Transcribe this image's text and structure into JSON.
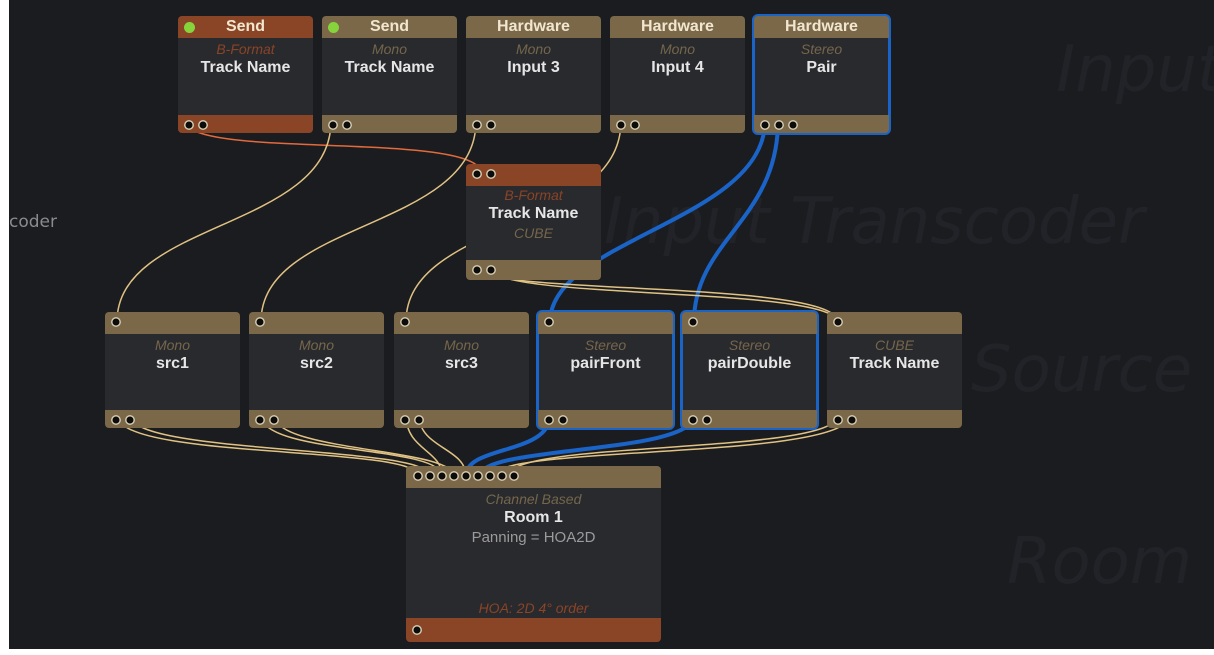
{
  "background_labels": [
    "Input",
    "Input Transcoder",
    "Source",
    "Room"
  ],
  "side_label": "coder",
  "colors": {
    "canvas": "#1b1c1f",
    "node_body": "#292a2e",
    "tan": "#7a6848",
    "orange": "#8a4426",
    "selection": "#1a64c8",
    "wire_tan": "#e0c283",
    "wire_orange": "#e26a3c",
    "wire_blue": "#1a64c8",
    "led": "#86d33b"
  },
  "inputs": [
    {
      "header": "Send",
      "format": "B-Format",
      "name": "Track Name",
      "style": "orange",
      "led": true,
      "selected": false
    },
    {
      "header": "Send",
      "format": "Mono",
      "name": "Track Name",
      "style": "tan",
      "led": true,
      "selected": false
    },
    {
      "header": "Hardware",
      "format": "Mono",
      "name": "Input 3",
      "style": "tan",
      "led": false,
      "selected": false
    },
    {
      "header": "Hardware",
      "format": "Mono",
      "name": "Input 4",
      "style": "tan",
      "led": false,
      "selected": false
    },
    {
      "header": "Hardware",
      "format": "Stereo",
      "name": "Pair",
      "style": "tan",
      "led": false,
      "selected": true
    }
  ],
  "transcoder": {
    "format": "B-Format",
    "name": "Track Name",
    "sub": "CUBE"
  },
  "sources": [
    {
      "format": "Mono",
      "name": "src1",
      "selected": false
    },
    {
      "format": "Mono",
      "name": "src2",
      "selected": false
    },
    {
      "format": "Mono",
      "name": "src3",
      "selected": false
    },
    {
      "format": "Stereo",
      "name": "pairFront",
      "selected": true
    },
    {
      "format": "Stereo",
      "name": "pairDouble",
      "selected": true
    },
    {
      "format": "CUBE",
      "name": "Track Name",
      "selected": false
    }
  ],
  "room": {
    "format": "Channel Based",
    "name": "Room 1",
    "panning": "Panning = HOA2D",
    "hoa": "HOA: 2D 4° order"
  }
}
